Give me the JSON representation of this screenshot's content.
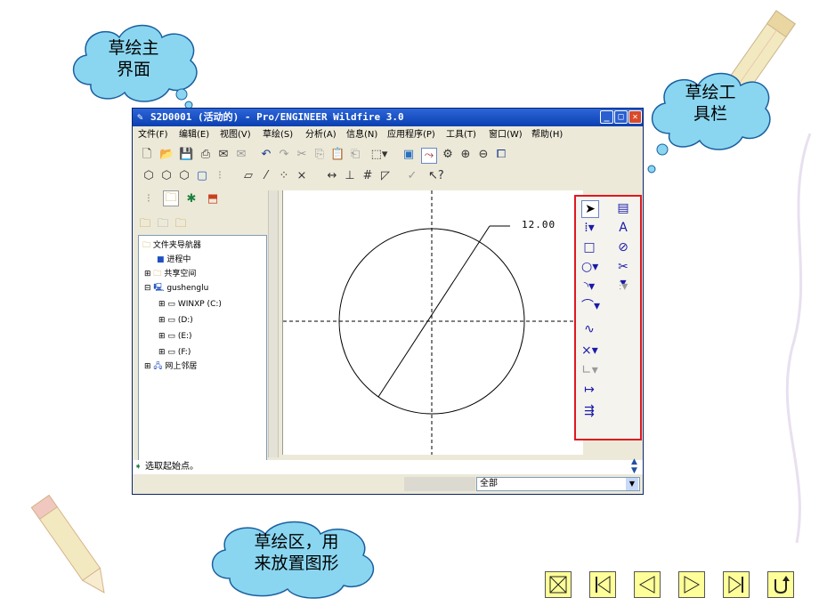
{
  "clouds": {
    "top_left": [
      "草绘主",
      "界面"
    ],
    "top_right": [
      "草绘工",
      "具栏"
    ],
    "bottom": [
      "草绘区，用",
      "来放置图形"
    ]
  },
  "window": {
    "title": "S2D0001 (活动的) - Pro/ENGINEER Wildfire 3.0",
    "minimize_icon": "minimize-icon",
    "maximize_icon": "maximize-icon",
    "close_icon": "close-icon"
  },
  "menu": {
    "items": [
      "文件(F)",
      "编辑(E)",
      "视图(V)",
      "草绘(S)",
      "分析(A)",
      "信息(N)",
      "应用程序(P)",
      "工具(T)",
      "窗口(W)",
      "帮助(H)"
    ]
  },
  "navigator": {
    "root_label": "文件夹导航器",
    "items": [
      "进程中",
      "共享空间",
      "gushenglu",
      "WINXP (C:)",
      "(D:)",
      "(E:)",
      "(F:)",
      "网上邻居"
    ]
  },
  "canvas": {
    "dimension_label": "12.00"
  },
  "status": {
    "message": "选取起始点。",
    "filter_value": "全部"
  },
  "colors": {
    "highlight_border": "#e0171f",
    "cloud_fill": "#8ad6f0",
    "title_bar": "#0a3fb0",
    "nav_button_fill": "#ffff99"
  }
}
